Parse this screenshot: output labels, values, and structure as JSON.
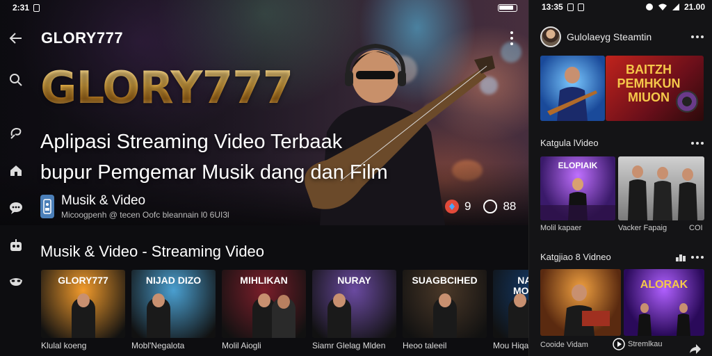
{
  "left_status": {
    "time": "2:31",
    "icon": "sim-icon"
  },
  "app": {
    "title": "GLORY777",
    "back_icon": "arrow-left-icon",
    "more_icon": "more-vertical-icon"
  },
  "rail": [
    {
      "name": "search-icon"
    },
    {
      "name": "swirl-icon"
    },
    {
      "name": "home-icon"
    },
    {
      "name": "chat-icon"
    },
    {
      "name": "robot-icon"
    },
    {
      "name": "mask-icon"
    }
  ],
  "hero": {
    "brand": "GLORY777",
    "headline_line1": "Aplipasi Streaming Video Terbaak",
    "headline_line2": "bupur Pemgemar Musik dang dan Film",
    "category": "Musik & Video",
    "category_sub": "Micoogpenh @ tecen Oofc bleannain l0 6UI3l",
    "stat_likes": "9",
    "stat_views": "88"
  },
  "section": {
    "title": "Musik & Video - Streaming Video",
    "thumbs": [
      {
        "title": "GLORY777",
        "label": "Klulal koeng",
        "bg": "#f29b2c"
      },
      {
        "title": "NIJAD DIZO",
        "label": "Mobl'Negalota",
        "bg": "#4a9fd0"
      },
      {
        "title": "MIHLIKAN",
        "label": "Molil Aiogli",
        "bg": "#7a1e2a"
      },
      {
        "title": "NURAY",
        "label": "Siamr Glelag Mlden",
        "bg": "#6a4aa0"
      },
      {
        "title": "SUAGBCIHED",
        "label": "Heoo taleeil",
        "bg": "#4a3828"
      },
      {
        "title": "NAAKK MOVILES",
        "label": "Mou Hiqao",
        "bg": "#123a6a"
      }
    ]
  },
  "right_status": {
    "time": "13:35",
    "right": "21.00"
  },
  "right": {
    "channel_name": "Gulolaeyg Steamtin",
    "promo_text": "BAITZH PEMHKUN MIUON",
    "section2_title": "Katgula lVideo",
    "cards2": [
      {
        "title": "ELOPIAIK",
        "label": "Molil kapaer"
      },
      {
        "title": "",
        "label": "Vacker Fapaig"
      }
    ],
    "cards2_extra": "COI",
    "section3_title": "Katgjiao 8 Vidneo",
    "cards3": [
      {
        "title": "",
        "label": "Cooide Vidam"
      },
      {
        "title": "ALORAK",
        "label": "Stremlkau"
      }
    ]
  }
}
